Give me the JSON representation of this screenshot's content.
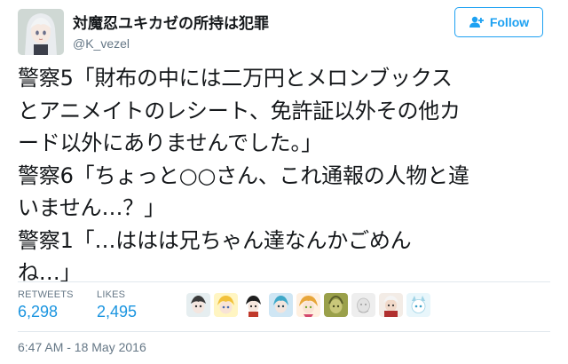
{
  "user": {
    "display_name": "対魔忍ユキカゼの所持は犯罪",
    "handle": "@K_vezel",
    "avatar_icon": "anime-girl-avatar-icon"
  },
  "follow_button": {
    "label": "Follow",
    "icon": "add-user-icon",
    "color": "#1da1f2"
  },
  "tweet": {
    "lines": [
      "警察5「財布の中には二万円とメロンブックス",
      "とアニメイトのレシート、免許証以外その他カ",
      "ード以外にありませんでした。」",
      "警察6「ちょっと○○さん、これ通報の人物と違",
      "いません…？」",
      "警察1「…ははは兄ちゃん達なんかごめん",
      "ね…」"
    ]
  },
  "stats": {
    "retweets_label": "RETWEETS",
    "retweets_count": "6,298",
    "likes_label": "LIKES",
    "likes_count": "2,495",
    "count_color": "#1b95e0"
  },
  "likers": [
    {
      "icon": "liker-avatar-icon"
    },
    {
      "icon": "liker-avatar-icon"
    },
    {
      "icon": "liker-avatar-icon"
    },
    {
      "icon": "liker-avatar-icon"
    },
    {
      "icon": "liker-avatar-icon"
    },
    {
      "icon": "liker-avatar-icon"
    },
    {
      "icon": "liker-avatar-icon"
    },
    {
      "icon": "liker-avatar-icon"
    },
    {
      "icon": "liker-avatar-icon"
    }
  ],
  "timestamp": "6:47 AM - 18 May 2016"
}
